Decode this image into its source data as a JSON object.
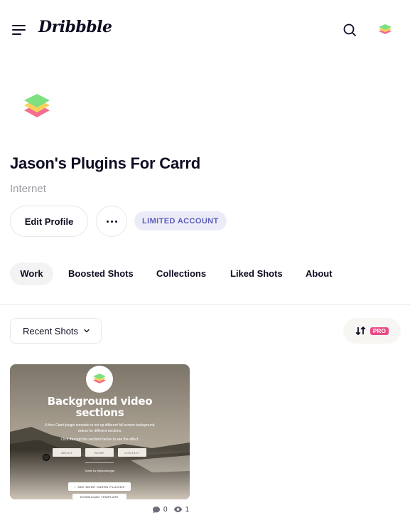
{
  "header": {
    "logo_text": "Dribbble",
    "menu_icon": "hamburger-menu-icon",
    "search_icon": "search-icon",
    "avatar_icon": "layers-logo-icon"
  },
  "profile": {
    "name": "Jason's Plugins For Carrd",
    "category": "Internet",
    "edit_label": "Edit Profile",
    "more_icon": "ellipsis-icon",
    "badge": "LIMITED ACCOUNT"
  },
  "tabs": [
    {
      "label": "Work",
      "active": true
    },
    {
      "label": "Boosted Shots",
      "active": false
    },
    {
      "label": "Collections",
      "active": false
    },
    {
      "label": "Liked Shots",
      "active": false
    },
    {
      "label": "About",
      "active": false
    }
  ],
  "filters": {
    "selected": "Recent Shots",
    "sort_badge": "PRO"
  },
  "shots": [
    {
      "title_line1": "Background video",
      "title_line2": "sections",
      "description_line1": "A free Carrd plugin template to set up different full screen background",
      "description_line2": "videos for different sections.",
      "description_line3": "Click through the sections below to see the effect.",
      "buttons": [
        "ABOUT",
        "WORK",
        "CONTACT"
      ],
      "made_by": "Made by @jasonbeggs",
      "more_plugins": "SEE MORE CARRD PLUGINS",
      "download": "DOWNLOAD TEMPLATE",
      "comments": "0",
      "views": "1"
    }
  ],
  "colors": {
    "pink": "#ea4c89",
    "badge_bg": "#ececf8",
    "badge_text": "#5d5dbd",
    "layer_green": "#7ee081",
    "layer_yellow": "#f7d15b",
    "layer_pink": "#f36d8f"
  }
}
